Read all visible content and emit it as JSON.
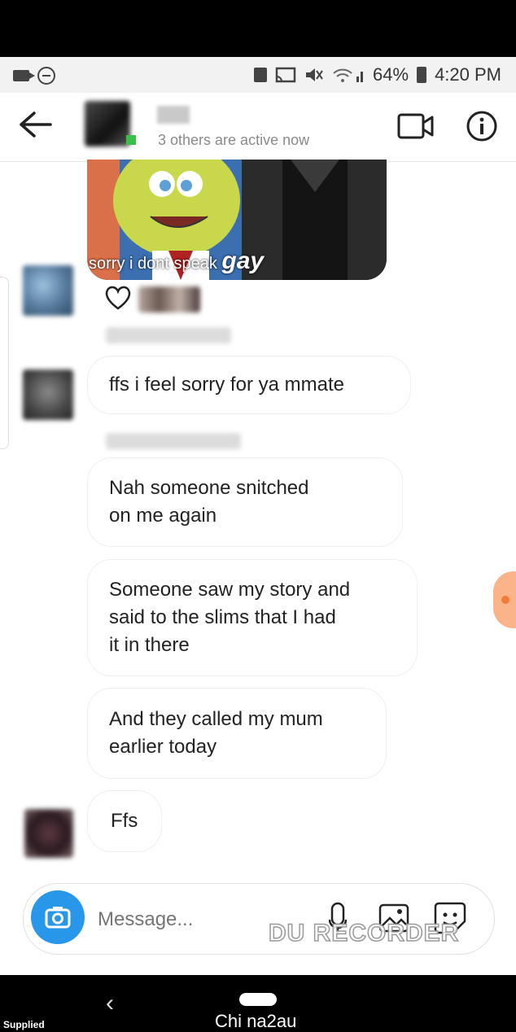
{
  "status_bar": {
    "battery": "64%",
    "time": "4:20 PM"
  },
  "header": {
    "subtitle": "3 others are active now"
  },
  "meme": {
    "caption": "sorry i dont speak",
    "caption_emphasis": "gay"
  },
  "messages": [
    {
      "text": "ffs i feel sorry for ya mmate"
    },
    {
      "lines": [
        "Nah someone snitched",
        "on me again"
      ]
    },
    {
      "lines": [
        "Someone saw my story and",
        "said to the slims that I had",
        "it in there"
      ]
    },
    {
      "lines": [
        "And they called my mum",
        "earlier today"
      ]
    },
    {
      "text": "Ffs"
    }
  ],
  "composer": {
    "placeholder": "Message..."
  },
  "watermark": "DU RECORDER",
  "nav": {
    "back_glyph": "‹"
  },
  "overlay": {
    "supplied": "Supplied",
    "credit": "Chi na2au"
  },
  "icons": [
    "video-icon",
    "dnd-icon",
    "battery-icon",
    "back-arrow-icon",
    "video-call-icon",
    "info-icon",
    "heart-icon",
    "camera-icon",
    "mic-icon",
    "gallery-icon",
    "sticker-icon"
  ]
}
